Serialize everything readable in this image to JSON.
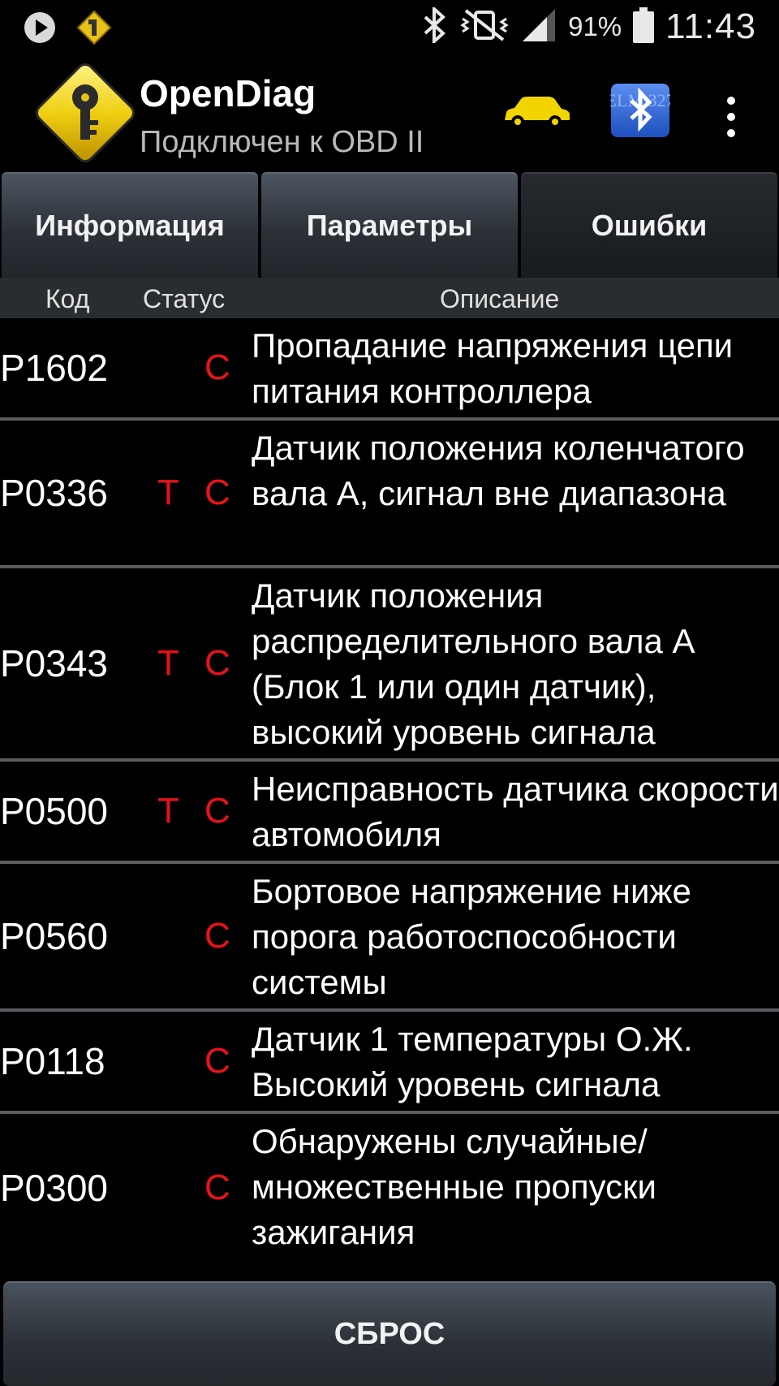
{
  "status_bar": {
    "battery_percent": "91%",
    "time": "11:43"
  },
  "app": {
    "title": "OpenDiag",
    "subtitle": "Подключен к OBD II",
    "bt_badge_text": "ELM 327"
  },
  "tabs": [
    {
      "label": "Информация",
      "active": false
    },
    {
      "label": "Параметры",
      "active": false
    },
    {
      "label": "Ошибки",
      "active": true
    }
  ],
  "table": {
    "headers": {
      "code": "Код",
      "status": "Статус",
      "description": "Описание"
    },
    "rows": [
      {
        "code": "P1602",
        "t": "",
        "c": "C",
        "description": "Пропадание напряжения цепи питания контроллера"
      },
      {
        "code": "P0336",
        "t": "T",
        "c": "C",
        "description": "Датчик положения коленчатого вала А, сигнал вне диапазона"
      },
      {
        "code": "P0343",
        "t": "T",
        "c": "C",
        "description": "Датчик положения распределительного вала А (Блок 1 или один датчик), высокий уровень сигнала"
      },
      {
        "code": "P0500",
        "t": "T",
        "c": "C",
        "description": "Неисправность датчика скорости автомобиля"
      },
      {
        "code": "P0560",
        "t": "",
        "c": "C",
        "description": "Бортовое напряжение ниже порога работоспособности системы"
      },
      {
        "code": "P0118",
        "t": "",
        "c": "C",
        "description": "Датчик 1 температуры О.Ж. Высокий уровень сигнала"
      },
      {
        "code": "P0300",
        "t": "",
        "c": "C",
        "description": "Обнаружены случайные/ множественные пропуски зажигания"
      }
    ]
  },
  "reset_label": "СБРОС",
  "colors": {
    "status_red": "#e8121a",
    "car_yellow": "#f2d400",
    "bt_blue": "#2a63d8"
  }
}
